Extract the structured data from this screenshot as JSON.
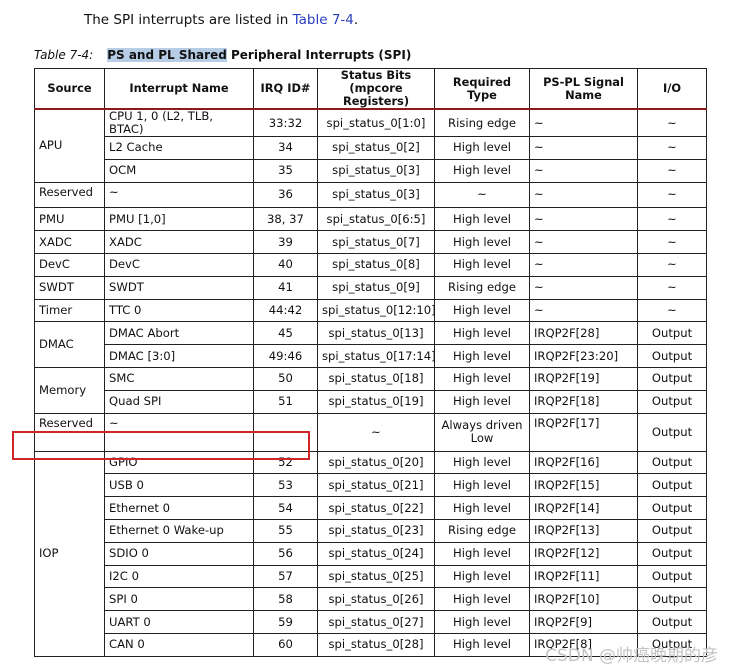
{
  "intro": {
    "text": "The SPI interrupts are listed in ",
    "link": "Table 7-4",
    "end": "."
  },
  "caption": {
    "number": "Table 7-4:",
    "highlighted": "PS and PL Shared",
    "rest": " Peripheral Interrupts (SPI)"
  },
  "headers": [
    "Source",
    "Interrupt Name",
    "IRQ ID#",
    "Status Bits (mpcore Registers)",
    "Required Type",
    "PS-PL Signal Name",
    "I/O"
  ],
  "rows": [
    {
      "source": "APU",
      "span": 3,
      "name": "CPU 1, 0 (L2, TLB, BTAC)",
      "irq": "33:32",
      "status": "spi_status_0[1:0]",
      "type": "Rising edge",
      "signal": "~",
      "io": "~"
    },
    {
      "name": "L2 Cache",
      "irq": "34",
      "status": "spi_status_0[2]",
      "type": "High level",
      "signal": "~",
      "io": "~"
    },
    {
      "name": "OCM",
      "irq": "35",
      "status": "spi_status_0[3]",
      "type": "High level",
      "signal": "~",
      "io": "~"
    },
    {
      "source": "Reserved",
      "span": 1,
      "name": "~",
      "irq": "36",
      "status": "spi_status_0[3]",
      "type": "~",
      "signal": "~",
      "io": "~"
    },
    {
      "source": "PMU",
      "span": 1,
      "name": "PMU [1,0]",
      "irq": "38, 37",
      "status": "spi_status_0[6:5]",
      "type": "High level",
      "signal": "~",
      "io": "~"
    },
    {
      "source": "XADC",
      "span": 1,
      "name": "XADC",
      "irq": "39",
      "status": "spi_status_0[7]",
      "type": "High level",
      "signal": "~",
      "io": "~"
    },
    {
      "source": "DevC",
      "span": 1,
      "name": "DevC",
      "irq": "40",
      "status": "spi_status_0[8]",
      "type": "High level",
      "signal": "~",
      "io": "~"
    },
    {
      "source": "SWDT",
      "span": 1,
      "name": "SWDT",
      "irq": "41",
      "status": "spi_status_0[9]",
      "type": "Rising edge",
      "signal": "~",
      "io": "~"
    },
    {
      "source": "Timer",
      "span": 1,
      "name": "TTC 0",
      "irq": "44:42",
      "status": "spi_status_0[12:10]",
      "type": "High level",
      "signal": "~",
      "io": "~"
    },
    {
      "source": "DMAC",
      "span": 2,
      "name": "DMAC Abort",
      "irq": "45",
      "status": "spi_status_0[13]",
      "type": "High level",
      "signal": "IRQP2F[28]",
      "io": "Output"
    },
    {
      "name": "DMAC [3:0]",
      "irq": "49:46",
      "status": "spi_status_0[17:14]",
      "type": "High level",
      "signal": "IRQP2F[23:20]",
      "io": "Output"
    },
    {
      "source": "Memory",
      "span": 2,
      "name": "SMC",
      "irq": "50",
      "status": "spi_status_0[18]",
      "type": "High level",
      "signal": "IRQP2F[19]",
      "io": "Output"
    },
    {
      "name": "Quad SPI",
      "irq": "51",
      "status": "spi_status_0[19]",
      "type": "High level",
      "signal": "IRQP2F[18]",
      "io": "Output"
    },
    {
      "source": "Reserved",
      "span": 1,
      "name": "~",
      "irq": "~",
      "status": "~",
      "type": "Always driven Low",
      "signal": "IRQP2F[17]",
      "io": "Output",
      "tall": true
    },
    {
      "source": "IOP",
      "span": 9,
      "name": "GPIO",
      "irq": "52",
      "status": "spi_status_0[20]",
      "type": "High level",
      "signal": "IRQP2F[16]",
      "io": "Output"
    },
    {
      "name": "USB 0",
      "irq": "53",
      "status": "spi_status_0[21]",
      "type": "High level",
      "signal": "IRQP2F[15]",
      "io": "Output"
    },
    {
      "name": "Ethernet 0",
      "irq": "54",
      "status": "spi_status_0[22]",
      "type": "High level",
      "signal": "IRQP2F[14]",
      "io": "Output"
    },
    {
      "name": "Ethernet 0 Wake-up",
      "irq": "55",
      "status": "spi_status_0[23]",
      "type": "Rising edge",
      "signal": "IRQP2F[13]",
      "io": "Output"
    },
    {
      "name": "SDIO 0",
      "irq": "56",
      "status": "spi_status_0[24]",
      "type": "High level",
      "signal": "IRQP2F[12]",
      "io": "Output"
    },
    {
      "name": "I2C 0",
      "irq": "57",
      "status": "spi_status_0[25]",
      "type": "High level",
      "signal": "IRQP2F[11]",
      "io": "Output"
    },
    {
      "name": "SPI 0",
      "irq": "58",
      "status": "spi_status_0[26]",
      "type": "High level",
      "signal": "IRQP2F[10]",
      "io": "Output"
    },
    {
      "name": "UART 0",
      "irq": "59",
      "status": "spi_status_0[27]",
      "type": "High level",
      "signal": "IRQP2F[9]",
      "io": "Output"
    },
    {
      "name": "CAN 0",
      "irq": "60",
      "status": "spi_status_0[28]",
      "type": "High level",
      "signal": "IRQP2F[8]",
      "io": "Output"
    }
  ],
  "watermark": "CSDN @帅癌晚期的彦",
  "colors": {
    "link": "#2a3fbf",
    "highlight": "#b7cde6",
    "header_rule": "#8b1a1a",
    "annotation_box": "#d0242b"
  }
}
